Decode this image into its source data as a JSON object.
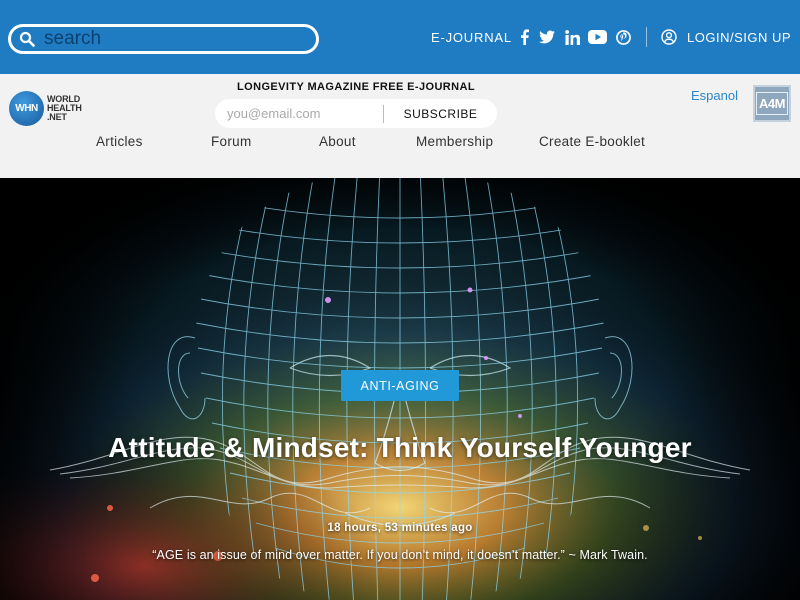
{
  "topbar": {
    "search": {
      "placeholder": "search"
    },
    "ejournal_label": "E-JOURNAL",
    "social_icons": [
      "facebook-icon",
      "twitter-icon",
      "linkedin-icon",
      "youtube-icon",
      "pinterest-icon"
    ],
    "login_label": "LOGIN/SIGN UP"
  },
  "header": {
    "logo_text": [
      "WORLD",
      "HEALTH",
      ".NET"
    ],
    "logo_mark": "WHN",
    "promo_title": "LONGEVITY MAGAZINE FREE E-JOURNAL",
    "email_placeholder": "you@email.com",
    "subscribe_label": "SUBSCRIBE",
    "language_link": "Espanol",
    "a4m_logo": "A4M",
    "nav": [
      "Articles",
      "Forum",
      "About",
      "Membership",
      "Create E-booklet"
    ]
  },
  "hero": {
    "category": "ANTI-AGING",
    "headline": "Attitude & Mindset: Think Yourself Younger",
    "timestamp": "18 hours, 53 minutes ago",
    "excerpt": "“AGE is an issue of mind over matter. If you don’t mind, it doesn’t matter.” ~ Mark Twain."
  },
  "colors": {
    "topbar_bg": "#1f7cc2",
    "header_bg": "#f2f2f2",
    "tag_bg": "#2199d9",
    "accent_link": "#2a86c9"
  }
}
